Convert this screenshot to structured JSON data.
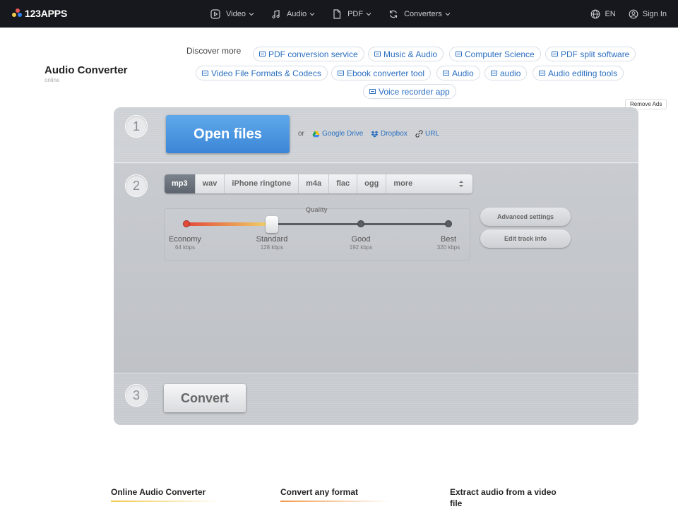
{
  "header": {
    "logo_text": "123APPS",
    "nav": [
      {
        "label": "Video",
        "icon": "play-icon"
      },
      {
        "label": "Audio",
        "icon": "music-note-icon"
      },
      {
        "label": "PDF",
        "icon": "document-icon"
      },
      {
        "label": "Converters",
        "icon": "refresh-icon"
      }
    ],
    "language": "EN",
    "sign_in": "Sign In"
  },
  "discover": {
    "label": "Discover more",
    "chips": [
      "PDF conversion service",
      "Music & Audio",
      "Computer Science",
      "PDF split software",
      "Video File Formats & Codecs",
      "Ebook converter tool",
      "Audio",
      "audio",
      "Audio editing tools",
      "Voice recorder app"
    ]
  },
  "app": {
    "title": "Audio Converter",
    "subtitle": "online"
  },
  "remove_ads": "Remove Ads",
  "steps": {
    "step1": "1",
    "step2": "2",
    "step3": "3"
  },
  "open": {
    "button": "Open files",
    "or": "or",
    "sources": [
      "Google Drive",
      "Dropbox",
      "URL"
    ]
  },
  "formats": {
    "items": [
      "mp3",
      "wav",
      "iPhone ringtone",
      "m4a",
      "flac",
      "ogg",
      "more"
    ],
    "selected": "mp3"
  },
  "quality": {
    "title": "Quality",
    "levels": [
      {
        "label": "Economy",
        "kbps": "64 kbps"
      },
      {
        "label": "Standard",
        "kbps": "128 kbps"
      },
      {
        "label": "Good",
        "kbps": "192 kbps"
      },
      {
        "label": "Best",
        "kbps": "320 kbps"
      }
    ],
    "selected_index": 1
  },
  "side_buttons": {
    "advanced": "Advanced settings",
    "track_info": "Edit track info"
  },
  "convert": {
    "button": "Convert"
  },
  "features": [
    {
      "title": "Online Audio Converter",
      "color": "#f2c94c"
    },
    {
      "title": "Convert any format",
      "color": "#f2994a"
    },
    {
      "title": "Extract audio from a video file",
      "color": "#f2c94c"
    }
  ],
  "colors": {
    "topbar": "#16181d",
    "link": "#2b6fc0",
    "open_button": "#4a96e0",
    "logo_dots": [
      "#f2c94c",
      "#eb5757",
      "#2f80ed"
    ]
  }
}
